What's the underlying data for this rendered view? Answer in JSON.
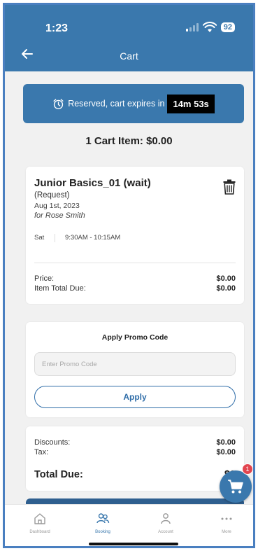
{
  "status_bar": {
    "time": "1:23",
    "battery": "92"
  },
  "header": {
    "title": "Cart",
    "back_icon": "arrow-left-icon"
  },
  "reservation": {
    "text": "Reserved, cart expires in",
    "timer": "14m 53s",
    "icon": "alarm-clock-icon"
  },
  "cart_summary": "1 Cart Item: $0.00",
  "item": {
    "name": "Junior Basics_01 (wait)",
    "type": "(Request)",
    "date": "Aug 1st, 2023",
    "for": "for Rose Smith",
    "day": "Sat",
    "time": "9:30AM - 10:15AM",
    "price_label": "Price:",
    "price_value": "$0.00",
    "total_label": "Item Total Due:",
    "total_value": "$0.00",
    "delete_icon": "trash-icon"
  },
  "promo": {
    "title": "Apply Promo Code",
    "placeholder": "Enter Promo Code",
    "button": "Apply"
  },
  "totals": {
    "discounts_label": "Discounts:",
    "discounts_value": "$0.00",
    "tax_label": "Tax:",
    "tax_value": "$0.00",
    "total_due_label": "Total Due:",
    "total_due_value": "$0"
  },
  "cart_fab": {
    "badge": "1",
    "icon": "shopping-cart-icon"
  },
  "tabs": [
    {
      "label": "Dashboard",
      "icon": "home-icon",
      "active": false
    },
    {
      "label": "Booking",
      "icon": "users-icon",
      "active": true
    },
    {
      "label": "Account",
      "icon": "person-icon",
      "active": false
    },
    {
      "label": "More",
      "icon": "more-dots-icon",
      "active": false
    }
  ],
  "colors": {
    "primary": "#3a78ad",
    "badge": "#e2454f",
    "timer_bg": "#000000"
  }
}
